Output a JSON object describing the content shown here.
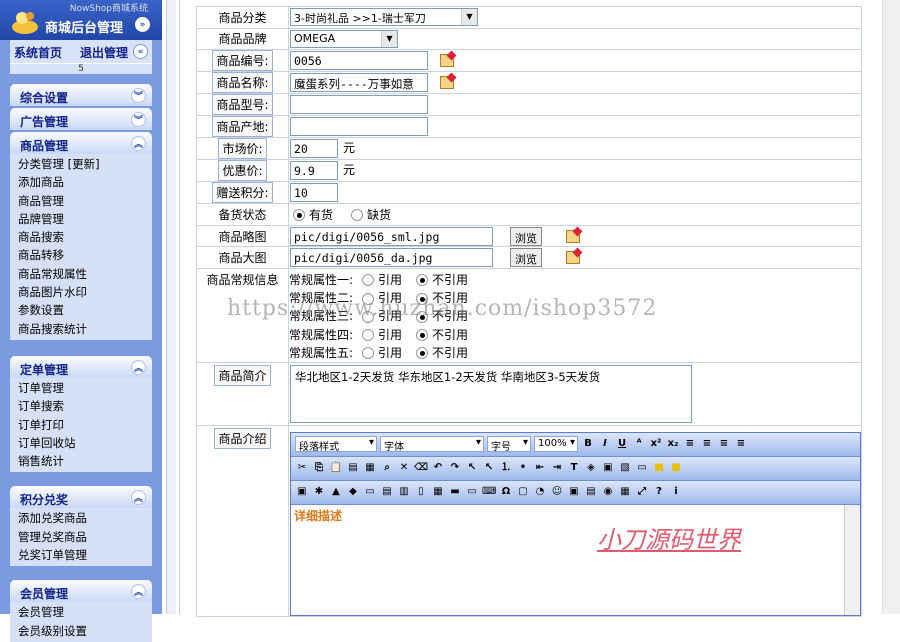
{
  "sidebar": {
    "system_tag": "NowShop商城系统",
    "title": "商城后台管理",
    "home_link": "系统首页",
    "logout_link": "退出管理",
    "counter": "5",
    "sections": [
      {
        "title": "综合设置",
        "items": []
      },
      {
        "title": "广告管理",
        "items": []
      },
      {
        "title": "商品管理",
        "items": [
          "分类管理 [更新]",
          "添加商品",
          "商品管理",
          "品牌管理",
          "商品搜索",
          "商品转移",
          "商品常规属性",
          "商品图片水印",
          "参数设置",
          "商品搜索统计"
        ]
      },
      {
        "title": "定单管理",
        "items": [
          "订单管理",
          "订单搜索",
          "订单打印",
          "订单回收站",
          "销售统计"
        ]
      },
      {
        "title": "积分兑奖",
        "items": [
          "添加兑奖商品",
          "管理兑奖商品",
          "兑奖订单管理"
        ]
      },
      {
        "title": "会员管理",
        "items": [
          "会员管理",
          "会员级别设置"
        ]
      }
    ]
  },
  "form": {
    "category": {
      "label": "商品分类",
      "value": "3-时尚礼品 >>1-瑞士军刀"
    },
    "brand": {
      "label": "商品品牌",
      "value": "OMEGA"
    },
    "code": {
      "label": "商品编号:",
      "value": "0056"
    },
    "name": {
      "label": "商品名称:",
      "value": "魔蛋系列----万事如意"
    },
    "model": {
      "label": "商品型号:",
      "value": ""
    },
    "origin": {
      "label": "商品产地:",
      "value": ""
    },
    "market_price": {
      "label": "市场价:",
      "value": "20",
      "unit": "元"
    },
    "sale_price": {
      "label": "优惠价:",
      "value": "9.9",
      "unit": "元"
    },
    "points": {
      "label": "赠送积分:",
      "value": "10"
    },
    "stock": {
      "label": "备货状态",
      "options": [
        "有货",
        "缺货"
      ],
      "selected": "有货"
    },
    "thumb": {
      "label": "商品略图",
      "value": "pic/digi/0056_sml.jpg",
      "button": "浏览"
    },
    "big": {
      "label": "商品大图",
      "value": "pic/digi/0056_da.jpg",
      "button": "浏览"
    },
    "attrs": {
      "label": "商品常规信息",
      "rows": [
        {
          "name": "常规属性一:",
          "opt1": "引用",
          "opt2": "不引用"
        },
        {
          "name": "常规属性二:",
          "opt1": "引用",
          "opt2": "不引用"
        },
        {
          "name": "常规属性三:",
          "opt1": "引用",
          "opt2": "不引用"
        },
        {
          "name": "常规属性四:",
          "opt1": "引用",
          "opt2": "不引用"
        },
        {
          "name": "常规属性五:",
          "opt1": "引用",
          "opt2": "不引用"
        }
      ]
    },
    "summary": {
      "label": "商品简介",
      "value": "华北地区1-2天发货 华东地区1-2天发货 华南地区3-5天发货"
    },
    "intro": {
      "label": "商品介绍",
      "style_select": "段落样式",
      "font_select": "字体",
      "size_select": "字号",
      "zoom_select": "100%",
      "placeholder": "详细描述"
    }
  },
  "watermark": "https://www.huzhan.com/ishop3572",
  "watermark2": "小刀源码世界"
}
